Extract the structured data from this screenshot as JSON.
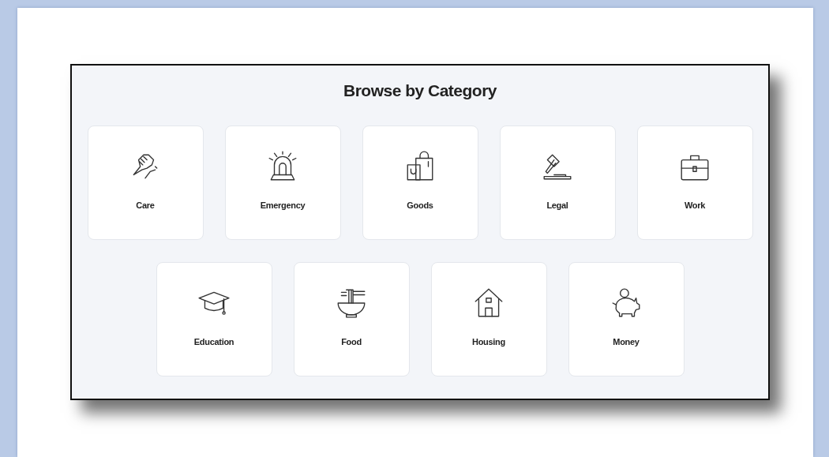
{
  "title": "Browse by Category",
  "rows": [
    [
      {
        "label": "Care",
        "kind": "care"
      },
      {
        "label": "Emergency",
        "kind": "emergency"
      },
      {
        "label": "Goods",
        "kind": "goods"
      },
      {
        "label": "Legal",
        "kind": "legal"
      },
      {
        "label": "Work",
        "kind": "work"
      }
    ],
    [
      {
        "label": "Education",
        "kind": "education"
      },
      {
        "label": "Food",
        "kind": "food"
      },
      {
        "label": "Housing",
        "kind": "housing"
      },
      {
        "label": "Money",
        "kind": "money"
      }
    ]
  ]
}
